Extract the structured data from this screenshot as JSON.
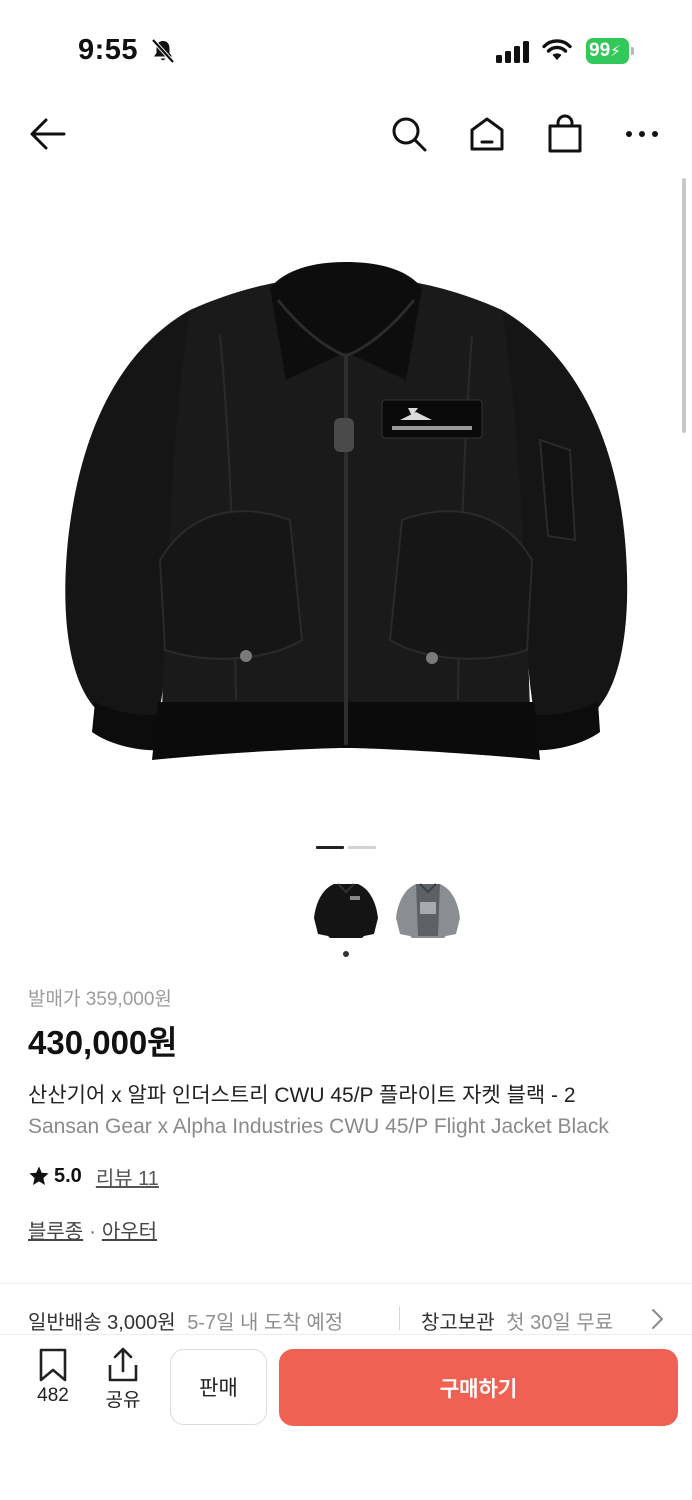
{
  "status_bar": {
    "time": "9:55",
    "battery": "99"
  },
  "nav": {
    "icons": [
      "back-arrow-icon",
      "search-icon",
      "home-icon",
      "shopping-bag-icon",
      "more-icon"
    ]
  },
  "gallery": {
    "thumbnails": [
      "black-jacket-thumbnail",
      "grey-jacket-thumbnail"
    ]
  },
  "product": {
    "release_price": "발매가 359,000원",
    "price": "430,000원",
    "title_ko": "산산기어 x 알파 인더스트리 CWU 45/P 플라이트 자켓 블랙 - 2",
    "title_en": "Sansan Gear x Alpha Industries CWU 45/P Flight Jacket Black",
    "rating": "5.0",
    "review_label": "리뷰 11",
    "categories": [
      "블루종",
      "아우터"
    ],
    "category_separator": "·"
  },
  "delivery": {
    "standard_label": "일반배송",
    "standard_price": "3,000원",
    "standard_eta": "5-7일 내 도착 예정",
    "storage_label": "창고보관",
    "storage_note": "첫 30일 무료"
  },
  "bottom_bar": {
    "saved_count": "482",
    "share_label": "공유",
    "sell_label": "판매",
    "buy_label": "구매하기"
  },
  "colors": {
    "accent": "#ef6253",
    "battery": "#34c759"
  }
}
